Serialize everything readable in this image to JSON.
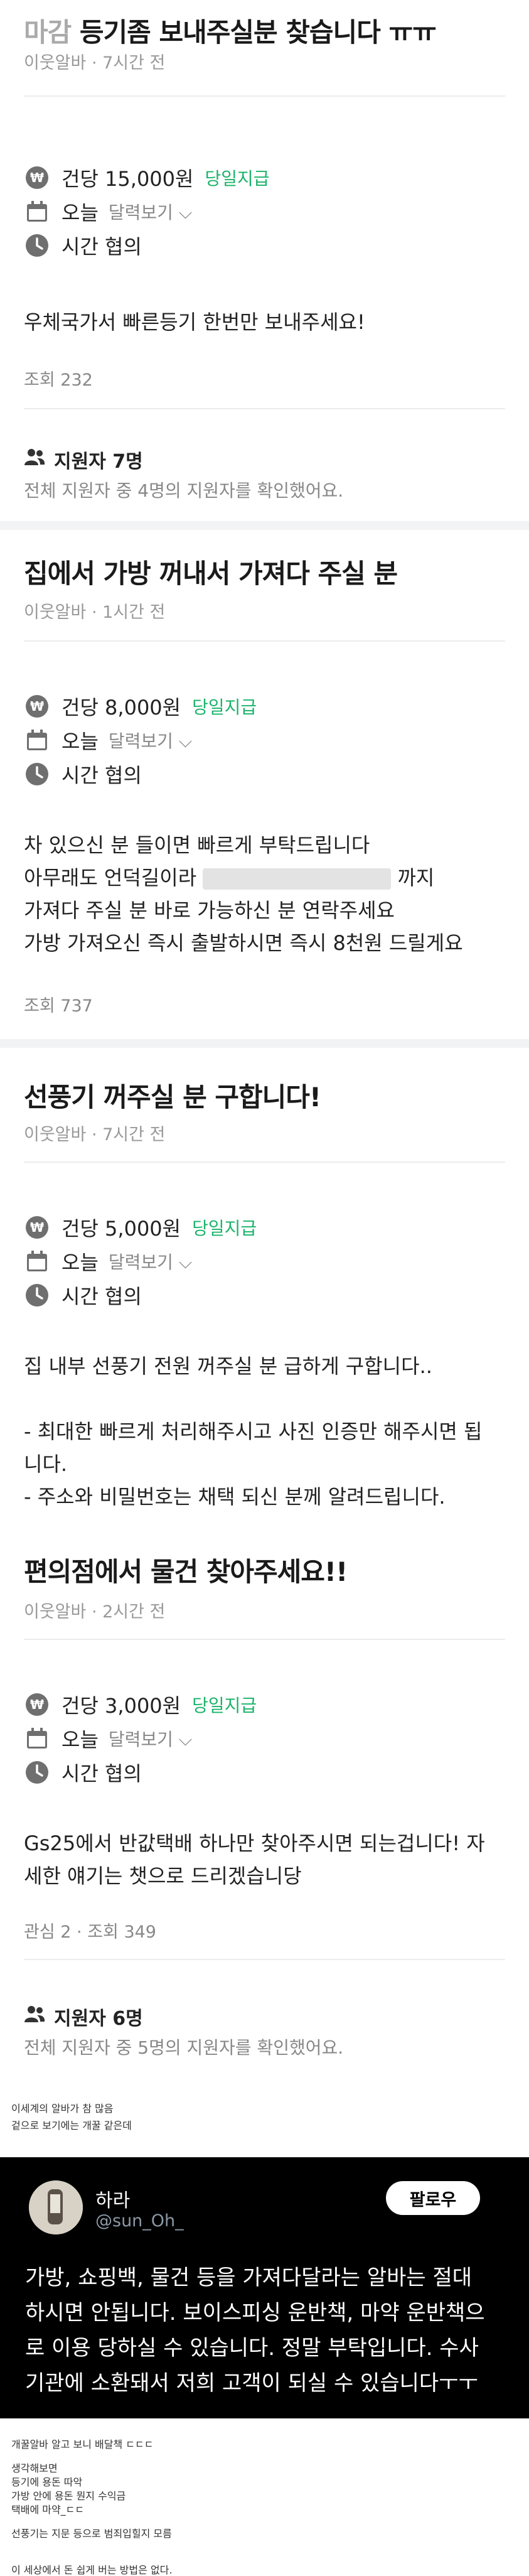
{
  "posts": [
    {
      "title_prefix": "마감",
      "title": "등기좀 보내주실분 찾습니다 ㅠㅠ",
      "meta": "이웃알바 · 7시간 전",
      "pay": "건당 15,000원",
      "pay_badge": "당일지급",
      "date": "오늘",
      "calendar_label": "달력보기",
      "time": "시간 협의",
      "body": [
        "우체국가서 빠른등기 한번만 보내주세요!"
      ],
      "stats": "조회 232"
    },
    {
      "title": "집에서 가방 꺼내서 가져다 주실 분",
      "meta": "이웃알바 · 1시간 전",
      "pay": "건당 8,000원",
      "pay_badge": "당일지급",
      "date": "오늘",
      "calendar_label": "달력보기",
      "time": "시간 협의",
      "body_line1": "차 있으신 분 들이면 빠르게 부탁드립니다",
      "body_line2_before": "아무래도 언덕길이라",
      "body_line2_after": "까지",
      "body_line3": "가져다 주실 분 바로 가능하신 분 연락주세요",
      "body_line4": "가방 가져오신 즉시 출발하시면 즉시 8천원 드릴게요",
      "stats": "조회 737"
    },
    {
      "title": "선풍기 꺼주실 분 구합니다!",
      "meta": "이웃알바 · 7시간 전",
      "pay": "건당 5,000원",
      "pay_badge": "당일지급",
      "date": "오늘",
      "calendar_label": "달력보기",
      "time": "시간 협의",
      "body": [
        "집 내부 선풍기 전원 꺼주실 분 급하게 구합니다..",
        "",
        "- 최대한 빠르게 처리해주시고 사진 인증만 해주시면 됩",
        "니다.",
        "- 주소와 비밀번호는 채택 되신 분께 알려드립니다."
      ]
    },
    {
      "title": "편의점에서 물건 찾아주세요!!",
      "meta": "이웃알바 · 2시간 전",
      "pay": "건당 3,000원",
      "pay_badge": "당일지급",
      "date": "오늘",
      "calendar_label": "달력보기",
      "time": "시간 협의",
      "body": [
        "Gs25에서 반값택배 하나만 찾아주시면 되는겁니다! 자",
        "세한 얘기는 챗으로 드리겠습니당"
      ],
      "stats": "관심 2 · 조회 349"
    }
  ],
  "applicants": [
    {
      "title": "지원자 7명",
      "sub": "전체 지원자 중 4명의 지원자를 확인했어요."
    },
    {
      "title": "지원자 6명",
      "sub": "전체 지원자 중 5명의 지원자를 확인했어요."
    }
  ],
  "notes_top": [
    "이세계의 알바가 참 많음",
    "겉으로 보기에는 개꿀 같은데"
  ],
  "tweet": {
    "name": "하라",
    "handle": "@sun_Oh_",
    "follow_label": "팔로우",
    "text": [
      "가방, 쇼핑백, 물건 등을 가져다달라는 알바는 절대",
      "하시면 안됩니다. 보이스피싱 운반책, 마약 운반책으",
      "로 이용 당하실 수 있습니다. 정말 부탁입니다. 수사",
      "기관에 소환돼서 저희 고객이 되실 수 있습니다ㅜㅜ"
    ]
  },
  "notes_bottom": [
    "개꿀알바 알고 보니 배달책 ㄷㄷㄷ",
    "",
    "생각해보면",
    "등기에 용돈 따악",
    "가방 안에 용돈 뭔지 수익금",
    "택배에 마약_ㄷㄷ",
    "",
    "선풍기는 지문 등으로 범죄입힐지 모름",
    "",
    "",
    "이 세상에서 돈 쉽게 버는 방법은 없다."
  ],
  "colors": {
    "accent_green": "#1bb36a",
    "muted": "#999999",
    "divider": "#f2f3f5",
    "tweet_bg": "#000000"
  }
}
